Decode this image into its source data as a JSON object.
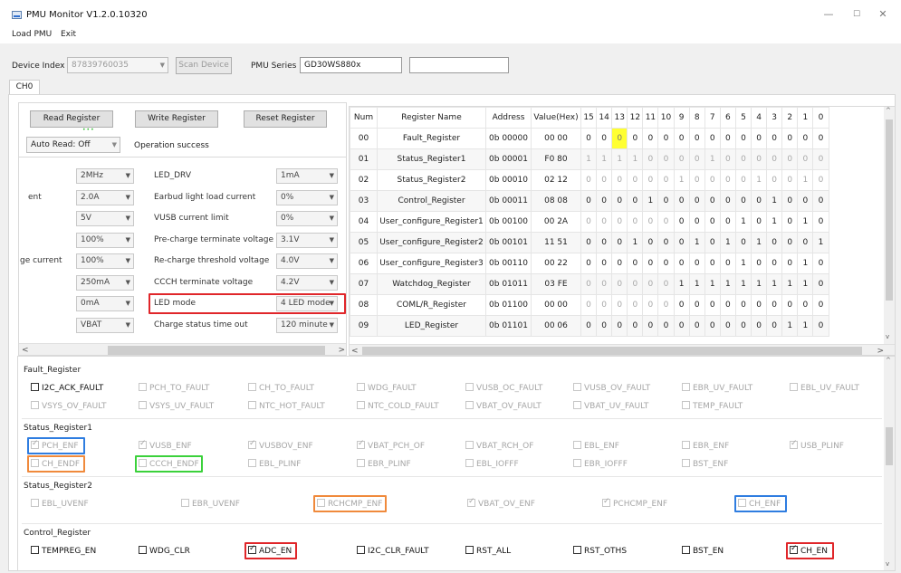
{
  "window": {
    "title": "PMU Monitor V1.2.0.10320",
    "minimize_glyph": "—",
    "maximize_glyph": "☐",
    "close_glyph": "✕"
  },
  "menu": {
    "items": [
      "Load PMU",
      "Exit"
    ]
  },
  "device": {
    "index_label": "Device Index",
    "index_value": "87839760035",
    "scan_button": "Scan Device",
    "series_label": "PMU Series",
    "series_value": "GD30WS880x",
    "extra_value": ""
  },
  "tabs": [
    "CH0"
  ],
  "controls": {
    "read_button": "Read Register",
    "write_button": "Write Register",
    "reset_button": "Reset Register",
    "auto_read": "Auto Read: Off",
    "status_text": "Operation success"
  },
  "settings": {
    "left_partials": [
      "",
      "ent",
      "",
      "",
      "ge current",
      "",
      "",
      ""
    ],
    "rows": [
      {
        "left": "2MHz",
        "label": "LED_DRV",
        "right": "1mA"
      },
      {
        "left": "2.0A",
        "label": "Earbud light load current",
        "right": "0%"
      },
      {
        "left": "5V",
        "label": "VUSB current limit",
        "right": "0%"
      },
      {
        "left": "100%",
        "label": "Pre-charge terminate voltage",
        "right": "3.1V"
      },
      {
        "left": "100%",
        "label": "Re-charge threshold voltage",
        "right": "4.0V"
      },
      {
        "left": "250mA",
        "label": "CCCH terminate voltage",
        "right": "4.2V"
      },
      {
        "left": "0mA",
        "label": "LED mode",
        "right": "4 LED mode"
      },
      {
        "left": "VBAT",
        "label": "Charge status time out",
        "right": "120 minute"
      }
    ]
  },
  "registers": {
    "headers": [
      "Num",
      "Register Name",
      "Address",
      "Value(Hex)",
      "15",
      "14",
      "13",
      "12",
      "11",
      "10",
      "9",
      "8",
      "7",
      "6",
      "5",
      "4",
      "3",
      "2",
      "1",
      "0"
    ],
    "rows": [
      {
        "num": "00",
        "name": "Fault_Register",
        "addr": "0b 00000",
        "val": "00 00",
        "bits": [
          "0",
          "0",
          "0",
          "0",
          "0",
          "0",
          "0",
          "0",
          "0",
          "0",
          "0",
          "0",
          "0",
          "0",
          "0",
          "0"
        ],
        "dim": false
      },
      {
        "num": "01",
        "name": "Status_Register1",
        "addr": "0b 00001",
        "val": "F0 80",
        "bits": [
          "1",
          "1",
          "1",
          "1",
          "0",
          "0",
          "0",
          "0",
          "1",
          "0",
          "0",
          "0",
          "0",
          "0",
          "0",
          "0"
        ],
        "dim": true
      },
      {
        "num": "02",
        "name": "Status_Register2",
        "addr": "0b 00010",
        "val": "02 12",
        "bits": [
          "0",
          "0",
          "0",
          "0",
          "0",
          "0",
          "1",
          "0",
          "0",
          "0",
          "0",
          "1",
          "0",
          "0",
          "1",
          "0"
        ],
        "dim": true
      },
      {
        "num": "03",
        "name": "Control_Register",
        "addr": "0b 00011",
        "val": "08 08",
        "bits": [
          "0",
          "0",
          "0",
          "0",
          "1",
          "0",
          "0",
          "0",
          "0",
          "0",
          "0",
          "0",
          "1",
          "0",
          "0",
          "0"
        ],
        "dim": false
      },
      {
        "num": "04",
        "name": "User_configure_Register1",
        "addr": "0b 00100",
        "val": "00 2A",
        "bits": [
          "0",
          "0",
          "0",
          "0",
          "0",
          "0",
          "0",
          "0",
          "0",
          "0",
          "1",
          "0",
          "1",
          "0",
          "1",
          "0"
        ],
        "dim": false
      },
      {
        "num": "05",
        "name": "User_configure_Register2",
        "addr": "0b 00101",
        "val": "11 51",
        "bits": [
          "0",
          "0",
          "0",
          "1",
          "0",
          "0",
          "0",
          "1",
          "0",
          "1",
          "0",
          "1",
          "0",
          "0",
          "0",
          "1"
        ],
        "dim": false
      },
      {
        "num": "06",
        "name": "User_configure_Register3",
        "addr": "0b 00110",
        "val": "00 22",
        "bits": [
          "0",
          "0",
          "0",
          "0",
          "0",
          "0",
          "0",
          "0",
          "0",
          "0",
          "1",
          "0",
          "0",
          "0",
          "1",
          "0"
        ],
        "dim": false
      },
      {
        "num": "07",
        "name": "Watchdog_Register",
        "addr": "0b 01011",
        "val": "03 FE",
        "bits": [
          "0",
          "0",
          "0",
          "0",
          "0",
          "0",
          "1",
          "1",
          "1",
          "1",
          "1",
          "1",
          "1",
          "1",
          "1",
          "0"
        ],
        "dim": false
      },
      {
        "num": "08",
        "name": "COML/R_Register",
        "addr": "0b 01100",
        "val": "00 00",
        "bits": [
          "0",
          "0",
          "0",
          "0",
          "0",
          "0",
          "0",
          "0",
          "0",
          "0",
          "0",
          "0",
          "0",
          "0",
          "0",
          "0"
        ],
        "dim": false
      },
      {
        "num": "09",
        "name": "LED_Register",
        "addr": "0b 01101",
        "val": "00 06",
        "bits": [
          "0",
          "0",
          "0",
          "0",
          "0",
          "0",
          "0",
          "0",
          "0",
          "0",
          "0",
          "0",
          "0",
          "1",
          "1",
          "0"
        ],
        "dim": false
      }
    ]
  },
  "bit_groups": [
    {
      "title": "Fault_Register",
      "rows": [
        [
          {
            "l": "I2C_ACK_FAULT",
            "on": true,
            "c": false
          },
          {
            "l": "PCH_TO_FAULT",
            "on": false,
            "c": false
          },
          {
            "l": "CH_TO_FAULT",
            "on": false,
            "c": false
          },
          {
            "l": "WDG_FAULT",
            "on": false,
            "c": false
          },
          {
            "l": "VUSB_OC_FAULT",
            "on": false,
            "c": false
          },
          {
            "l": "VUSB_OV_FAULT",
            "on": false,
            "c": false
          },
          {
            "l": "EBR_UV_FAULT",
            "on": false,
            "c": false
          },
          {
            "l": "EBL_UV_FAULT",
            "on": false,
            "c": false
          }
        ],
        [
          {
            "l": "VSYS_OV_FAULT",
            "on": false,
            "c": false
          },
          {
            "l": "VSYS_UV_FAULT",
            "on": false,
            "c": false
          },
          {
            "l": "NTC_HOT_FAULT",
            "on": false,
            "c": false
          },
          {
            "l": "NTC_COLD_FAULT",
            "on": false,
            "c": false
          },
          {
            "l": "VBAT_OV_FAULT",
            "on": false,
            "c": false
          },
          {
            "l": "VBAT_UV_FAULT",
            "on": false,
            "c": false
          },
          {
            "l": "TEMP_FAULT",
            "on": false,
            "c": false
          }
        ]
      ]
    },
    {
      "title": "Status_Register1",
      "rows": [
        [
          {
            "l": "PCH_ENF",
            "on": false,
            "c": true
          },
          {
            "l": "VUSB_ENF",
            "on": false,
            "c": true
          },
          {
            "l": "VUSBOV_ENF",
            "on": false,
            "c": true
          },
          {
            "l": "VBAT_PCH_OF",
            "on": false,
            "c": true
          },
          {
            "l": "VBAT_RCH_OF",
            "on": false,
            "c": false
          },
          {
            "l": "EBL_ENF",
            "on": false,
            "c": false
          },
          {
            "l": "EBR_ENF",
            "on": false,
            "c": false
          },
          {
            "l": "USB_PLINF",
            "on": false,
            "c": true
          }
        ],
        [
          {
            "l": "CH_ENDF",
            "on": false,
            "c": false
          },
          {
            "l": "CCCH_ENDF",
            "on": false,
            "c": false
          },
          {
            "l": "EBL_PLINF",
            "on": false,
            "c": false
          },
          {
            "l": "EBR_PLINF",
            "on": false,
            "c": false
          },
          {
            "l": "EBL_IOFFF",
            "on": false,
            "c": false
          },
          {
            "l": "EBR_IOFFF",
            "on": false,
            "c": false
          },
          {
            "l": "BST_ENF",
            "on": false,
            "c": false
          }
        ]
      ]
    },
    {
      "title": "Status_Register2",
      "rows": [
        [
          {
            "l": "EBL_UVENF",
            "on": false,
            "c": false
          },
          {
            "l": "EBR_UVENF",
            "on": false,
            "c": false
          },
          {
            "l": "RCHCMP_ENF",
            "on": false,
            "c": false
          },
          {
            "l": "VBAT_OV_ENF",
            "on": false,
            "c": true
          },
          {
            "l": "PCHCMP_ENF",
            "on": false,
            "c": true
          },
          {
            "l": "CH_ENF",
            "on": false,
            "c": false
          }
        ]
      ]
    },
    {
      "title": "Control_Register",
      "rows": [
        [
          {
            "l": "TEMPREG_EN",
            "on": true,
            "c": false
          },
          {
            "l": "WDG_CLR",
            "on": true,
            "c": false
          },
          {
            "l": "ADC_EN",
            "on": true,
            "c": true
          },
          {
            "l": "I2C_CLR_FAULT",
            "on": true,
            "c": false
          },
          {
            "l": "RST_ALL",
            "on": true,
            "c": false
          },
          {
            "l": "RST_OTHS",
            "on": true,
            "c": false
          },
          {
            "l": "BST_EN",
            "on": true,
            "c": false
          },
          {
            "l": "CH_EN",
            "on": true,
            "c": true
          }
        ]
      ]
    }
  ],
  "colors": {
    "red": "#e0262a",
    "blue": "#2f7de0",
    "orange": "#f08a3c",
    "green": "#3bd13b",
    "highlight": "#ffff33"
  }
}
